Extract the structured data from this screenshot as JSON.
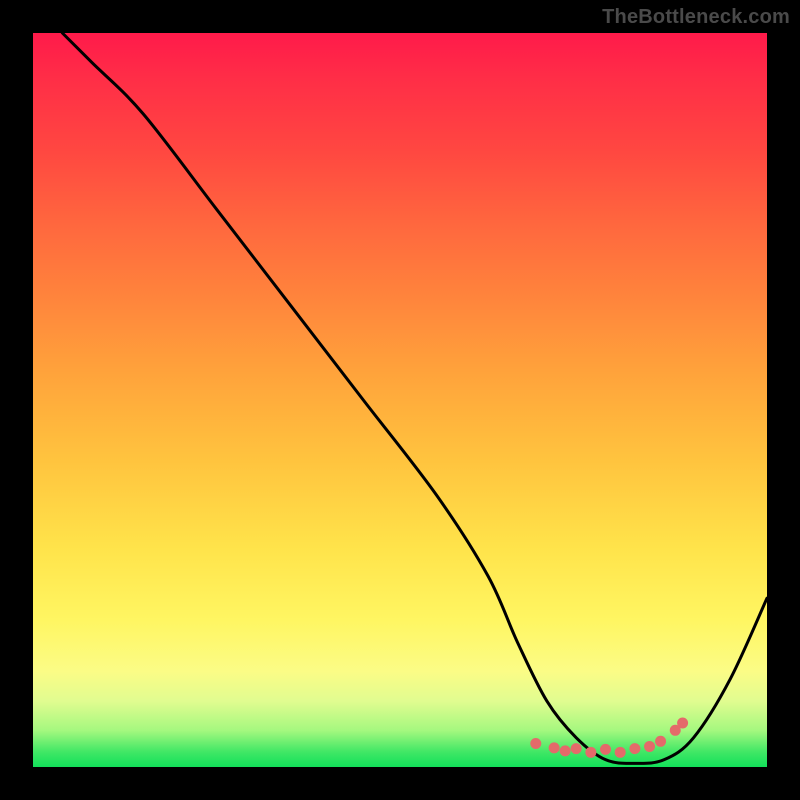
{
  "watermark": "TheBottleneck.com",
  "chart_data": {
    "type": "line",
    "title": "",
    "xlabel": "",
    "ylabel": "",
    "xlim": [
      0,
      100
    ],
    "ylim": [
      0,
      100
    ],
    "series": [
      {
        "name": "bottleneck-curve",
        "x": [
          4,
          8,
          15,
          25,
          35,
          45,
          55,
          62,
          66,
          70,
          74,
          78,
          82,
          86,
          90,
          95,
          100
        ],
        "y": [
          100,
          96,
          89,
          76,
          63,
          50,
          37,
          26,
          17,
          9,
          4,
          1,
          0.5,
          1,
          4,
          12,
          23
        ]
      }
    ],
    "markers": {
      "name": "valley-dots",
      "x": [
        68.5,
        71,
        72.5,
        74,
        76,
        78,
        80,
        82,
        84,
        85.5,
        87.5,
        88.5
      ],
      "y": [
        3.2,
        2.6,
        2.2,
        2.5,
        2.0,
        2.4,
        2.0,
        2.5,
        2.8,
        3.5,
        5.0,
        6.0
      ]
    },
    "colors": {
      "curve": "#000000",
      "markers": "#e46a6a",
      "gradient_top": "#ff1a4a",
      "gradient_bottom": "#12e05a"
    }
  }
}
